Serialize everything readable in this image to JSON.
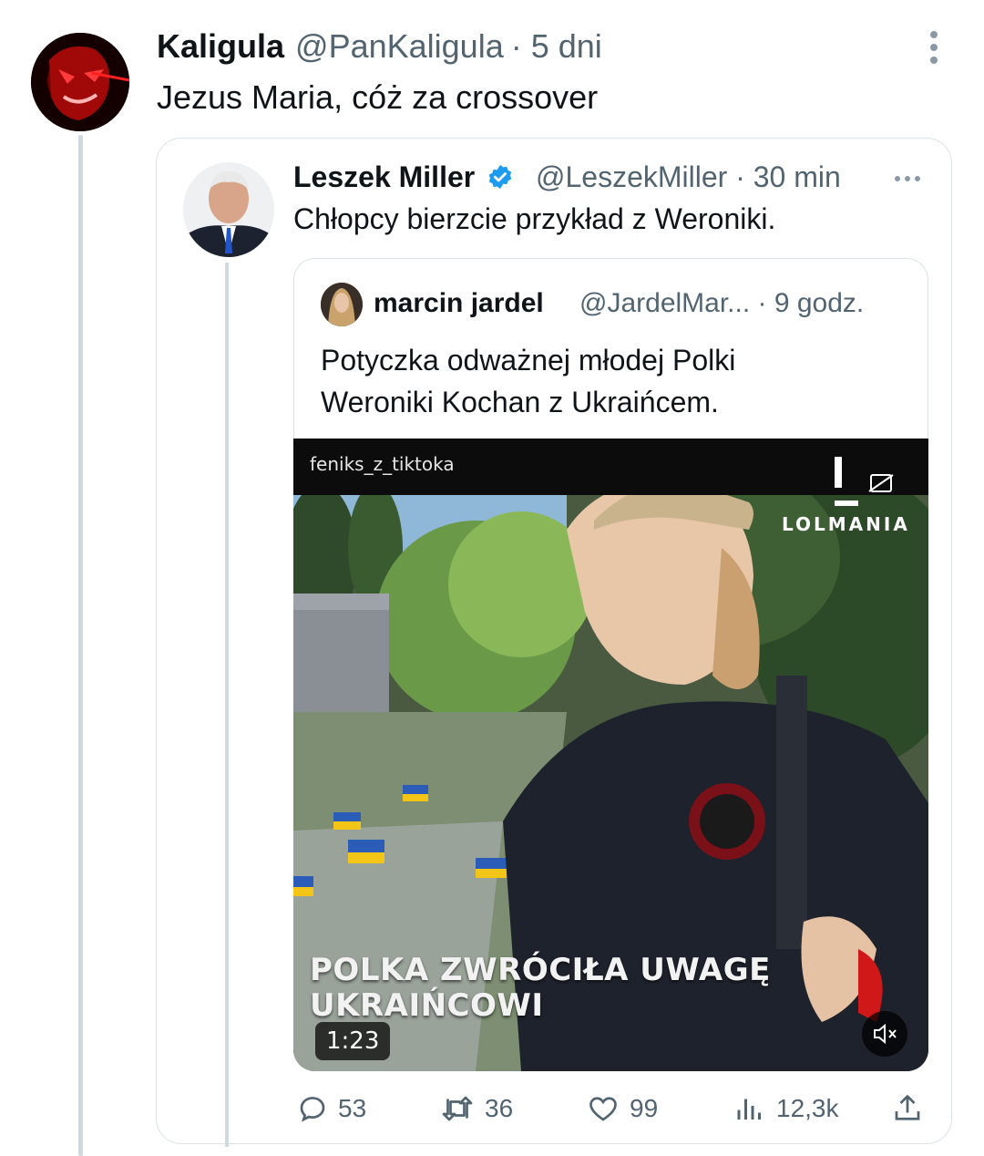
{
  "outer_tweet": {
    "display_name": "Kaligula",
    "handle": "@PanKaligula",
    "time": "· 5 dni",
    "text": "Jezus Maria, cóż za crossover"
  },
  "quoted_tweet": {
    "display_name": "Leszek Miller",
    "handle": "@LeszekMiller · 30 min",
    "text": "Chłopcy bierzcie przykład z Weroniki.",
    "verified": true
  },
  "inner_quoted_tweet": {
    "display_name": "marcin jardel",
    "handle": "@JardelMar... · 9 godz.",
    "text_line1": "Potyczka odważnej młodej Polki",
    "text_line2": "Weroniki Kochan z Ukraińcem."
  },
  "video": {
    "source_user": "feniks_z_tiktoka",
    "watermark": "LOLMANIA",
    "caption_line1": "POLKA ZWRÓCIŁA UWAGĘ",
    "caption_line2": "UKRAIŃCOWI",
    "duration": "1:23"
  },
  "actions": {
    "replies": "53",
    "retweets": "36",
    "likes": "99",
    "views": "12,3k"
  },
  "colors": {
    "primary_text": "#0f1419",
    "secondary_text": "#536471",
    "border": "#dbe3e7",
    "verified": "#1d9bf0"
  }
}
